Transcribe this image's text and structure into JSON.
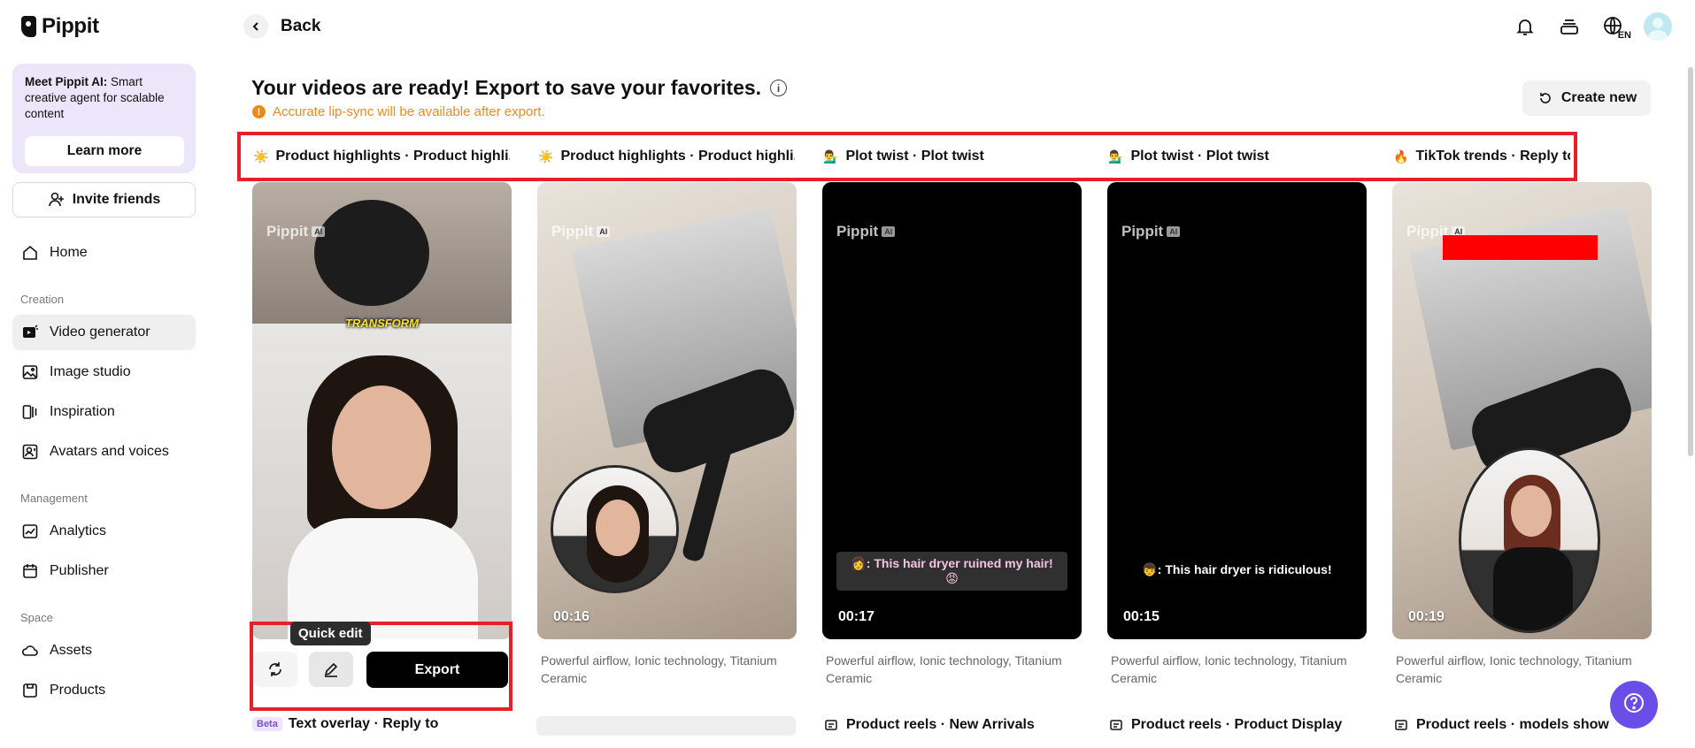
{
  "brand": {
    "name": "Pippit"
  },
  "promo": {
    "title": "Meet Pippit AI:",
    "body": "Smart creative agent for scalable content",
    "button": "Learn more"
  },
  "invite": {
    "label": "Invite friends"
  },
  "nav": {
    "home": "Home",
    "creation_section": "Creation",
    "video_generator": "Video generator",
    "image_studio": "Image studio",
    "inspiration": "Inspiration",
    "avatars": "Avatars and voices",
    "management_section": "Management",
    "analytics": "Analytics",
    "publisher": "Publisher",
    "space_section": "Space",
    "assets": "Assets",
    "products": "Products"
  },
  "header": {
    "back": "Back",
    "language": "EN"
  },
  "main": {
    "title": "Your videos are ready! Export to save your favorites.",
    "warning": "Accurate lip-sync will be available after export.",
    "create_new": "Create new"
  },
  "tabs": [
    {
      "emoji": "☀️",
      "label": "Product highlights · Product highli..."
    },
    {
      "emoji": "☀️",
      "label": "Product highlights · Product highli..."
    },
    {
      "emoji": "💁‍♂️",
      "label": "Plot twist · Plot twist"
    },
    {
      "emoji": "💁‍♂️",
      "label": "Plot twist · Plot twist"
    },
    {
      "emoji": "🔥",
      "label": "TikTok trends · Reply to"
    }
  ],
  "watermark": {
    "text": "Pippit",
    "ai": "AI"
  },
  "cards": [
    {
      "overlay": "TRANSFORM",
      "duration": "",
      "caption": "",
      "desc": ""
    },
    {
      "duration": "00:16",
      "caption": "",
      "desc": "Powerful airflow, Ionic technology, Titanium Ceramic"
    },
    {
      "duration": "00:17",
      "caption": "👩: This hair dryer ruined my hair! 😡",
      "desc": "Powerful airflow, Ionic technology, Titanium Ceramic"
    },
    {
      "duration": "00:15",
      "caption": "👦: This hair dryer is ridiculous!",
      "desc": "Powerful airflow, Ionic technology, Titanium Ceramic"
    },
    {
      "duration": "00:19",
      "caption": "",
      "desc": "Powerful airflow, Ionic technology, Titanium Ceramic"
    }
  ],
  "editbar": {
    "tooltip": "Quick edit",
    "export": "Export"
  },
  "bottom": {
    "beta": "Beta",
    "label1": "Text overlay · Reply to",
    "label3": "Product reels · New Arrivals",
    "label4": "Product reels · Product Display",
    "label5": "Product reels · models show"
  },
  "colors": {
    "accent_red": "#e3202c",
    "warning": "#ef8a1b",
    "fab": "#6a4ee8",
    "promo_bg": "#ece6fb"
  }
}
